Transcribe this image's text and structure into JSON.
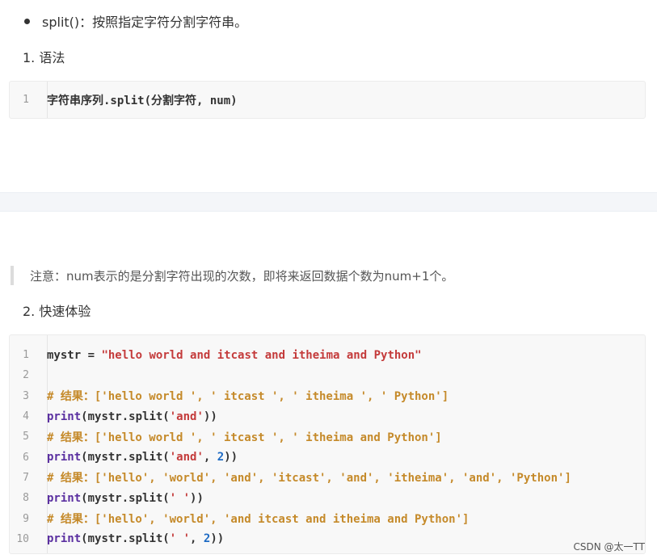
{
  "bullet": {
    "text": "split()：按照指定字符分割字符串。"
  },
  "section1": {
    "title": "1. 语法"
  },
  "syntax_code": {
    "lines": [
      {
        "num": "1",
        "text": "字符串序列.split(分割字符, num)"
      }
    ]
  },
  "note": {
    "text": "注意：num表示的是分割字符出现的次数，即将来返回数据个数为num+1个。"
  },
  "section2": {
    "title": "2. 快速体验"
  },
  "example_code": {
    "line_numbers": [
      "1",
      "2",
      "3",
      "4",
      "5",
      "6",
      "7",
      "8",
      "9",
      "10"
    ],
    "l1": {
      "var": "mystr = ",
      "str": "\"hello world and itcast and itheima and Python\""
    },
    "l3": "# 结果：['hello world ', ' itcast ', ' itheima ', ' Python']",
    "l4": {
      "fn": "print",
      "a": "(mystr.split(",
      "s": "'and'",
      "b": "))"
    },
    "l5": "# 结果：['hello world ', ' itcast ', ' itheima and Python']",
    "l6": {
      "fn": "print",
      "a": "(mystr.split(",
      "s": "'and'",
      "c": ", ",
      "n": "2",
      "b": "))"
    },
    "l7": "# 结果：['hello', 'world', 'and', 'itcast', 'and', 'itheima', 'and', 'Python']",
    "l8": {
      "fn": "print",
      "a": "(mystr.split(",
      "s": "' '",
      "b": "))"
    },
    "l9": "# 结果：['hello', 'world', 'and itcast and itheima and Python']",
    "l10": {
      "fn": "print",
      "a": "(mystr.split(",
      "s": "' '",
      "c": ", ",
      "n": "2",
      "b": "))"
    }
  },
  "watermark": {
    "text": "CSDN @太一TT"
  }
}
